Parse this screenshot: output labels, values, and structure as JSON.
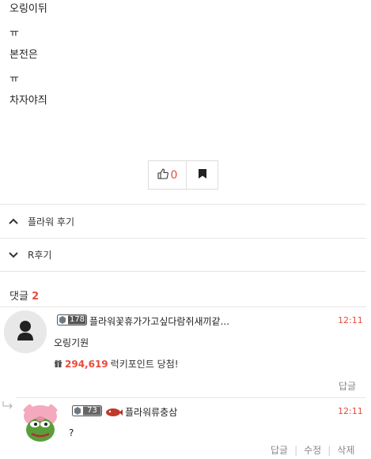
{
  "post": {
    "lines": [
      "오링이뒤",
      "ㅠ",
      "본전은",
      "ㅠ",
      "차자야즤"
    ]
  },
  "actions": {
    "like_count": "0"
  },
  "nav": {
    "prev_label": "플라워 후기",
    "next_label": "R후기"
  },
  "comments": {
    "label": "댓글",
    "count": "2",
    "items": [
      {
        "level": "178",
        "author": "플라워꽃휴가가고싶다람쥐새끼같...",
        "time": "12:11",
        "text": "오링기원",
        "luck_value": "294,619",
        "luck_text": "럭키포인트 당첨!",
        "reply_label": "답글"
      },
      {
        "level": "73",
        "author": "플라워류충삼",
        "time": "12:11",
        "text": "?",
        "reply_label": "답글",
        "edit_label": "수정",
        "delete_label": "삭제"
      }
    ]
  },
  "colors": {
    "accent": "#e74c3c",
    "border": "#dddddd"
  }
}
